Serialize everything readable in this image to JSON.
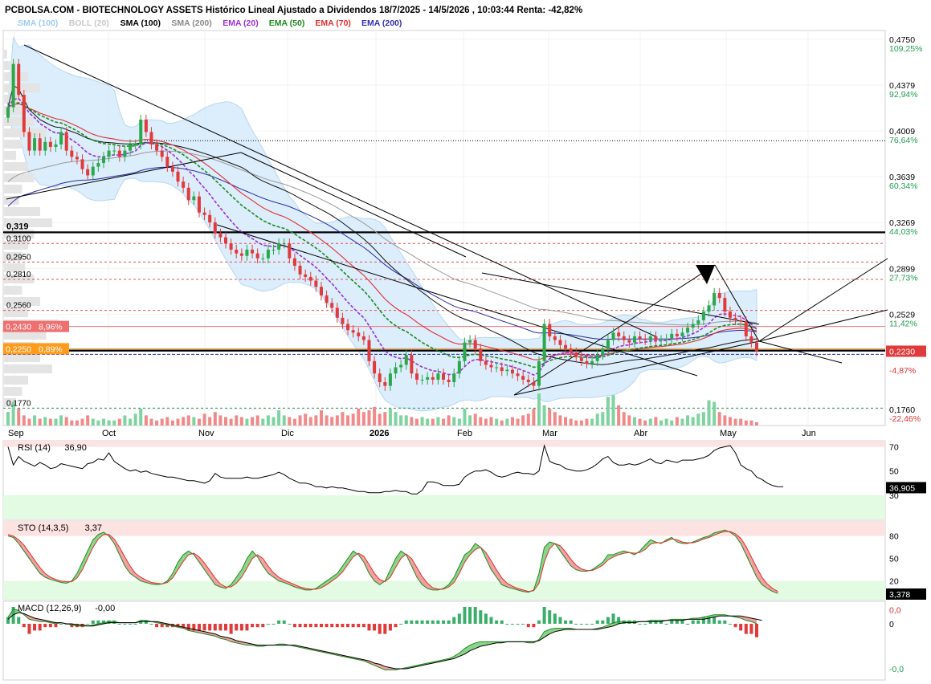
{
  "header": {
    "title": "PCBOLSA.COM - BIOTECHNOLOGY ASSETS Histórico Lineal Ajustado a Dividendos 18/7/2025 - 14/5/2026 , 10:03:44 Renta: -42,82%",
    "legend": [
      {
        "label": "SMA (100)",
        "color": "#9ecbf0"
      },
      {
        "label": "BOLL (20)",
        "color": "#c8c8c8"
      },
      {
        "label": "SMA (100)",
        "color": "#000000"
      },
      {
        "label": "SMA (200)",
        "color": "#8a8a8a"
      },
      {
        "label": "EMA (20)",
        "color": "#9b30d9"
      },
      {
        "label": "EMA (50)",
        "color": "#1f8a1f"
      },
      {
        "label": "EMA (70)",
        "color": "#e03030"
      },
      {
        "label": "EMA (200)",
        "color": "#3030b0"
      }
    ]
  },
  "chart_data": [
    {
      "type": "candlestick",
      "x_labels": [
        "Sep",
        "Oct",
        "Nov",
        "Dic",
        "2026",
        "Feb",
        "Mar",
        "Abr",
        "May",
        "Jun"
      ],
      "y_ticks": [
        "0,4750",
        "0,4379",
        "0,4009",
        "0,3639",
        "0,3269",
        "0,2899",
        "0,2529",
        "0,1760"
      ],
      "y_pct": [
        "109,25%",
        "92,94%",
        "76,64%",
        "60,34%",
        "44,03%",
        "27,73%",
        "11,42%",
        "-4,87%",
        "-22,46%"
      ],
      "last_price": "0,2230",
      "ylim": [
        0.163,
        0.482
      ],
      "levels": [
        {
          "label": "0,319",
          "value": 0.319,
          "style": "thick"
        },
        {
          "label": "0,3100",
          "value": 0.31,
          "style": "dashed"
        },
        {
          "label": "0,2950",
          "value": 0.295,
          "style": "dashed"
        },
        {
          "label": "0,2810",
          "value": 0.281,
          "style": "dashed"
        },
        {
          "label": "0,2560",
          "value": 0.256,
          "style": "dashed"
        },
        {
          "label": "0,2430",
          "pct": "8,96%",
          "value": 0.243,
          "style": "band-red"
        },
        {
          "label": "0,2250",
          "pct": "0,89%",
          "value": 0.225,
          "style": "band-orange"
        },
        {
          "label": "0,1770",
          "value": 0.177,
          "style": "dashed-green"
        }
      ],
      "close": [
        0.42,
        0.455,
        0.43,
        0.4,
        0.385,
        0.395,
        0.385,
        0.392,
        0.388,
        0.39,
        0.4,
        0.385,
        0.38,
        0.378,
        0.37,
        0.365,
        0.372,
        0.375,
        0.38,
        0.385,
        0.385,
        0.38,
        0.385,
        0.39,
        0.39,
        0.41,
        0.4,
        0.39,
        0.385,
        0.38,
        0.372,
        0.368,
        0.36,
        0.355,
        0.345,
        0.348,
        0.335,
        0.333,
        0.327,
        0.318,
        0.315,
        0.31,
        0.305,
        0.302,
        0.3,
        0.305,
        0.302,
        0.298,
        0.298,
        0.305,
        0.305,
        0.31,
        0.31,
        0.298,
        0.292,
        0.285,
        0.283,
        0.28,
        0.275,
        0.268,
        0.262,
        0.258,
        0.25,
        0.245,
        0.24,
        0.238,
        0.235,
        0.232,
        0.215,
        0.205,
        0.198,
        0.195,
        0.205,
        0.21,
        0.212,
        0.22,
        0.205,
        0.2,
        0.2,
        0.202,
        0.2,
        0.205,
        0.2,
        0.198,
        0.205,
        0.215,
        0.23,
        0.232,
        0.225,
        0.215,
        0.212,
        0.21,
        0.21,
        0.207,
        0.208,
        0.205,
        0.203,
        0.2,
        0.198,
        0.195,
        0.215,
        0.245,
        0.235,
        0.232,
        0.228,
        0.225,
        0.222,
        0.218,
        0.215,
        0.213,
        0.215,
        0.22,
        0.225,
        0.232,
        0.238,
        0.235,
        0.232,
        0.23,
        0.235,
        0.233,
        0.232,
        0.235,
        0.232,
        0.232,
        0.233,
        0.237,
        0.235,
        0.238,
        0.242,
        0.245,
        0.248,
        0.255,
        0.26,
        0.27,
        0.266,
        0.255,
        0.25,
        0.248,
        0.247,
        0.235,
        0.23,
        0.223
      ],
      "volume": [
        0.4,
        0.7,
        0.5,
        0.3,
        0.2,
        0.3,
        0.2,
        0.25,
        0.2,
        0.2,
        0.3,
        0.25,
        0.15,
        0.15,
        0.2,
        0.3,
        0.2,
        0.15,
        0.2,
        0.15,
        0.15,
        0.2,
        0.3,
        0.2,
        0.35,
        0.5,
        0.3,
        0.2,
        0.15,
        0.2,
        0.25,
        0.15,
        0.2,
        0.25,
        0.3,
        0.25,
        0.2,
        0.35,
        0.25,
        0.4,
        0.3,
        0.25,
        0.2,
        0.3,
        0.25,
        0.2,
        0.25,
        0.3,
        0.2,
        0.3,
        0.25,
        0.45,
        0.3,
        0.25,
        0.2,
        0.3,
        0.35,
        0.25,
        0.3,
        0.45,
        0.3,
        0.25,
        0.3,
        0.4,
        0.3,
        0.35,
        0.5,
        0.4,
        0.45,
        0.55,
        0.35,
        0.4,
        0.5,
        0.4,
        0.3,
        0.3,
        0.25,
        0.2,
        0.25,
        0.2,
        0.2,
        0.25,
        0.2,
        0.3,
        0.25,
        0.2,
        0.5,
        0.3,
        0.35,
        0.25,
        0.2,
        0.25,
        0.2,
        0.15,
        0.2,
        0.25,
        0.2,
        0.3,
        0.35,
        0.5,
        0.95,
        0.6,
        0.5,
        0.4,
        0.3,
        0.25,
        0.2,
        0.15,
        0.15,
        0.2,
        0.2,
        0.35,
        0.4,
        0.85,
        0.9,
        0.6,
        0.4,
        0.3,
        0.25,
        0.2,
        0.15,
        0.2,
        0.25,
        0.15,
        0.2,
        0.15,
        0.25,
        0.2,
        0.3,
        0.25,
        0.35,
        0.4,
        0.75,
        0.7,
        0.4,
        0.3,
        0.25,
        0.2,
        0.2,
        0.15,
        0.15,
        0.1
      ]
    },
    {
      "type": "line",
      "name": "RSI (14)",
      "value_label": "36,90",
      "badge": "36,905",
      "y_ticks": [
        "70",
        "50",
        "30"
      ],
      "ylim": [
        10,
        75
      ],
      "values": [
        70,
        55,
        62,
        58,
        56,
        54,
        57,
        55,
        52,
        53,
        56,
        55,
        54,
        53,
        52,
        56,
        57,
        60,
        59,
        65,
        58,
        55,
        52,
        50,
        51,
        49,
        50,
        48,
        47,
        46,
        45,
        45,
        44,
        43,
        42,
        42,
        41,
        40,
        42,
        48,
        45,
        44,
        44,
        44,
        44,
        45,
        44,
        44,
        45,
        46,
        47,
        49,
        47,
        44,
        42,
        40,
        40,
        39,
        37,
        37,
        36,
        37,
        36,
        36,
        35,
        34,
        33,
        33,
        32,
        32,
        32,
        33,
        33,
        34,
        33,
        33,
        31,
        31,
        34,
        41,
        41,
        40,
        38,
        38,
        38,
        39,
        45,
        48,
        50,
        50,
        51,
        49,
        46,
        45,
        46,
        48,
        49,
        48,
        48,
        47,
        50,
        71,
        58,
        56,
        55,
        52,
        51,
        50,
        50,
        51,
        53,
        56,
        60,
        62,
        57,
        55,
        55,
        56,
        55,
        56,
        58,
        60,
        57,
        56,
        59,
        58,
        57,
        59,
        59,
        59,
        60,
        61,
        63,
        67,
        69,
        70,
        71,
        65,
        55,
        52,
        50,
        45,
        43,
        40,
        38,
        37,
        36.9
      ]
    },
    {
      "type": "line",
      "name": "STO (14,3,5)",
      "value_label": "3,37",
      "badge": "3,378",
      "y_ticks": [
        "80",
        "50",
        "20"
      ],
      "ylim": [
        -5,
        100
      ],
      "k": [
        80,
        78,
        70,
        60,
        50,
        40,
        30,
        25,
        22,
        20,
        18,
        17,
        20,
        30,
        45,
        60,
        75,
        82,
        85,
        80,
        70,
        55,
        40,
        30,
        25,
        20,
        18,
        16,
        15,
        16,
        20,
        30,
        45,
        55,
        60,
        55,
        45,
        35,
        25,
        15,
        12,
        10,
        15,
        25,
        35,
        50,
        60,
        52,
        40,
        30,
        25,
        20,
        18,
        15,
        12,
        10,
        8,
        8,
        10,
        15,
        20,
        25,
        30,
        40,
        50,
        60,
        55,
        45,
        30,
        20,
        15,
        20,
        35,
        50,
        60,
        55,
        40,
        25,
        15,
        10,
        8,
        8,
        10,
        15,
        25,
        40,
        55,
        60,
        70,
        65,
        50,
        35,
        25,
        15,
        12,
        10,
        8,
        6,
        5,
        8,
        30,
        65,
        72,
        70,
        60,
        50,
        40,
        35,
        33,
        33,
        35,
        40,
        45,
        55,
        55,
        58,
        60,
        58,
        55,
        60,
        68,
        75,
        72,
        70,
        75,
        78,
        72,
        70,
        70,
        72,
        75,
        78,
        80,
        84,
        86,
        88,
        85,
        80,
        70,
        55,
        40,
        25,
        15,
        10,
        6,
        3.4
      ],
      "d": [
        82,
        80,
        75,
        68,
        58,
        48,
        38,
        30,
        25,
        22,
        20,
        19,
        19,
        24,
        35,
        50,
        65,
        76,
        82,
        82,
        76,
        65,
        52,
        40,
        30,
        25,
        21,
        18,
        17,
        16,
        18,
        24,
        35,
        46,
        55,
        57,
        52,
        44,
        34,
        24,
        16,
        12,
        12,
        17,
        25,
        37,
        50,
        55,
        50,
        40,
        31,
        25,
        21,
        18,
        15,
        12,
        10,
        9,
        9,
        11,
        15,
        20,
        25,
        32,
        42,
        52,
        57,
        53,
        42,
        30,
        22,
        19,
        25,
        38,
        50,
        56,
        50,
        38,
        26,
        17,
        11,
        9,
        9,
        12,
        18,
        30,
        45,
        55,
        62,
        65,
        58,
        47,
        35,
        24,
        17,
        13,
        10,
        8,
        6,
        7,
        17,
        45,
        63,
        70,
        67,
        59,
        49,
        41,
        36,
        34,
        34,
        37,
        41,
        48,
        52,
        55,
        57,
        58,
        57,
        58,
        62,
        69,
        71,
        71,
        73,
        76,
        75,
        72,
        71,
        71,
        73,
        76,
        78,
        81,
        84,
        86,
        86,
        83,
        77,
        66,
        52,
        38,
        25,
        16,
        10,
        6
      ],
      "overbought": 80,
      "oversold": 20
    },
    {
      "type": "line",
      "name": "MACD (12,26,9)",
      "value_label": "-0,00",
      "y_ticks": [
        "0,0",
        "0",
        "-0,0"
      ],
      "ylim": [
        -0.05,
        0.02
      ],
      "macd": [
        0.006,
        0.013,
        0.012,
        0.008,
        0.004,
        0.003,
        0.002,
        0.002,
        0.001,
        0.0,
        0.001,
        0.0,
        -0.001,
        -0.002,
        -0.002,
        -0.002,
        -0.001,
        0.0,
        0.001,
        0.002,
        0.002,
        0.001,
        0.001,
        0.001,
        0.001,
        0.003,
        0.003,
        0.002,
        0.001,
        0.0,
        -0.001,
        -0.002,
        -0.003,
        -0.004,
        -0.006,
        -0.007,
        -0.008,
        -0.009,
        -0.01,
        -0.011,
        -0.013,
        -0.014,
        -0.016,
        -0.017,
        -0.018,
        -0.019,
        -0.019,
        -0.02,
        -0.02,
        -0.019,
        -0.019,
        -0.018,
        -0.018,
        -0.019,
        -0.02,
        -0.021,
        -0.022,
        -0.023,
        -0.024,
        -0.025,
        -0.026,
        -0.027,
        -0.028,
        -0.029,
        -0.03,
        -0.031,
        -0.032,
        -0.033,
        -0.035,
        -0.037,
        -0.039,
        -0.041,
        -0.041,
        -0.041,
        -0.04,
        -0.039,
        -0.038,
        -0.037,
        -0.036,
        -0.035,
        -0.034,
        -0.033,
        -0.032,
        -0.031,
        -0.029,
        -0.026,
        -0.022,
        -0.019,
        -0.017,
        -0.016,
        -0.016,
        -0.016,
        -0.016,
        -0.016,
        -0.016,
        -0.016,
        -0.016,
        -0.016,
        -0.017,
        -0.017,
        -0.014,
        -0.007,
        -0.005,
        -0.004,
        -0.004,
        -0.004,
        -0.004,
        -0.005,
        -0.005,
        -0.005,
        -0.005,
        -0.004,
        -0.003,
        -0.001,
        0.001,
        0.002,
        0.002,
        0.002,
        0.002,
        0.002,
        0.002,
        0.003,
        0.003,
        0.003,
        0.003,
        0.004,
        0.004,
        0.004,
        0.004,
        0.005,
        0.005,
        0.006,
        0.007,
        0.008,
        0.008,
        0.008,
        0.007,
        0.006,
        0.005,
        0.003,
        0.002,
        0.0
      ],
      "signal": [
        0.004,
        0.008,
        0.01,
        0.009,
        0.007,
        0.005,
        0.004,
        0.003,
        0.002,
        0.001,
        0.001,
        0.0,
        0.0,
        -0.001,
        -0.001,
        -0.002,
        -0.002,
        -0.001,
        0.0,
        0.001,
        0.001,
        0.001,
        0.001,
        0.001,
        0.001,
        0.002,
        0.002,
        0.002,
        0.002,
        0.001,
        0.0,
        -0.001,
        -0.002,
        -0.003,
        -0.004,
        -0.005,
        -0.006,
        -0.007,
        -0.008,
        -0.009,
        -0.011,
        -0.012,
        -0.013,
        -0.015,
        -0.016,
        -0.017,
        -0.018,
        -0.019,
        -0.019,
        -0.019,
        -0.019,
        -0.019,
        -0.019,
        -0.019,
        -0.019,
        -0.02,
        -0.021,
        -0.022,
        -0.023,
        -0.024,
        -0.025,
        -0.026,
        -0.027,
        -0.028,
        -0.029,
        -0.03,
        -0.031,
        -0.032,
        -0.033,
        -0.035,
        -0.036,
        -0.038,
        -0.039,
        -0.04,
        -0.04,
        -0.04,
        -0.039,
        -0.038,
        -0.037,
        -0.036,
        -0.035,
        -0.034,
        -0.033,
        -0.032,
        -0.031,
        -0.029,
        -0.027,
        -0.024,
        -0.022,
        -0.02,
        -0.019,
        -0.018,
        -0.017,
        -0.017,
        -0.016,
        -0.016,
        -0.016,
        -0.016,
        -0.016,
        -0.016,
        -0.015,
        -0.012,
        -0.009,
        -0.007,
        -0.006,
        -0.005,
        -0.005,
        -0.005,
        -0.005,
        -0.005,
        -0.005,
        -0.005,
        -0.004,
        -0.003,
        -0.002,
        0.0,
        0.001,
        0.001,
        0.001,
        0.002,
        0.002,
        0.002,
        0.002,
        0.002,
        0.003,
        0.003,
        0.003,
        0.003,
        0.004,
        0.004,
        0.004,
        0.004,
        0.005,
        0.006,
        0.007,
        0.007,
        0.007,
        0.007,
        0.007,
        0.006,
        0.005,
        0.004,
        0.003
      ]
    }
  ]
}
